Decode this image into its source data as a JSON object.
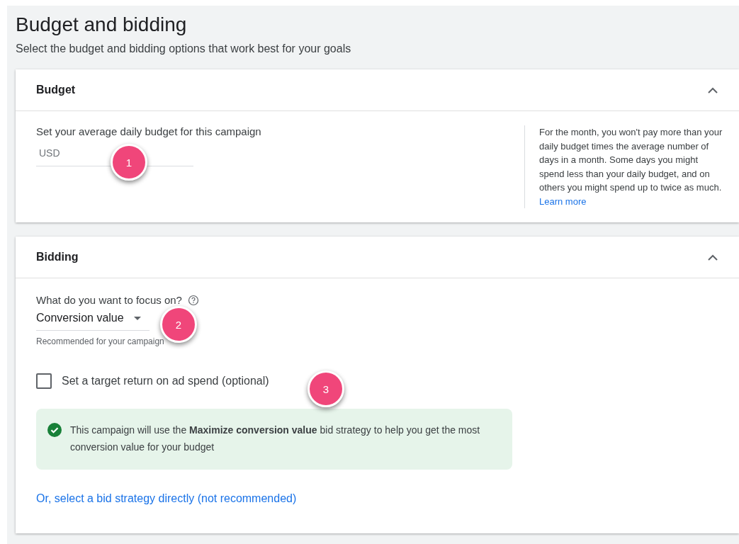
{
  "page": {
    "title": "Budget and bidding",
    "subtitle": "Select the budget and bidding options that work best for your goals"
  },
  "budget": {
    "title": "Budget",
    "expanded": true,
    "field_label": "Set your average daily budget for this campaign",
    "currency_placeholder": "USD",
    "help_text": "For the month, you won't pay more than your daily budget times the average number of days in a month. Some days you might spend less than your daily budget, and on others you might spend up to twice as much.",
    "help_link": "Learn more",
    "marker": "1"
  },
  "bidding": {
    "title": "Bidding",
    "expanded": true,
    "question": "What do you want to focus on?",
    "focus_value": "Conversion value",
    "focus_hint": "Recommended for your campaign",
    "focus_marker": "2",
    "target_checkbox": {
      "label": "Set a target return on ad spend (optional)",
      "checked": false
    },
    "checkbox_marker": "3",
    "notice": "This campaign will use the **Maximize conversion value** bid strategy to help you get the most conversion value for your budget",
    "strategy_link": "Or, select a bid strategy directly (not recommended)"
  }
}
